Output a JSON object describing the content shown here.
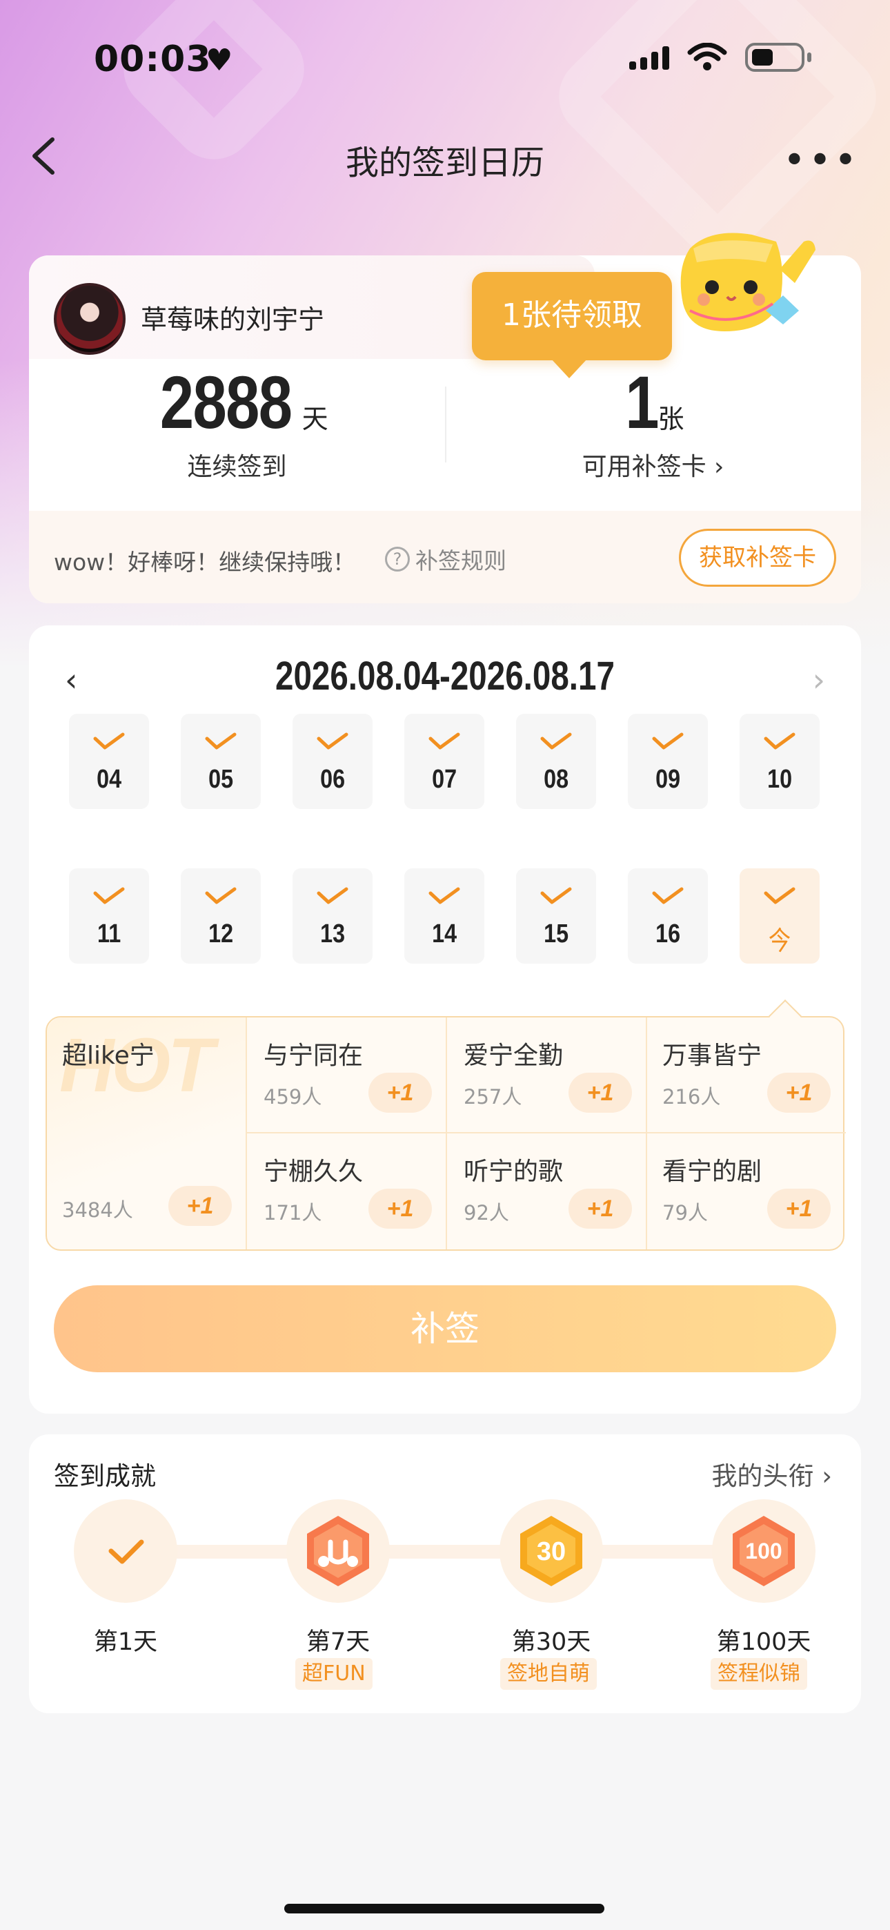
{
  "status_bar": {
    "time": "00:03",
    "heart": "♥"
  },
  "nav": {
    "title": "我的签到日历",
    "back_icon": "chevron-left-icon",
    "more_label": "•••"
  },
  "user": {
    "name": "草莓味的刘宇宁"
  },
  "stats": {
    "streak_value": "2888",
    "streak_unit": "天",
    "streak_label": "连续签到",
    "cards_value": "1",
    "cards_unit": "张",
    "cards_label": "可用补签卡 ›"
  },
  "pending_tip": "1张待领取",
  "encouragement": "wow！好棒呀！继续保持哦！",
  "rules_label": "补签规则",
  "get_card_button": "获取补签卡",
  "calendar": {
    "range": "2026.08.04-2026.08.17",
    "prev": "‹",
    "next": "›",
    "days": [
      "04",
      "05",
      "06",
      "07",
      "08",
      "09",
      "10",
      "11",
      "12",
      "13",
      "14",
      "15",
      "16",
      "今"
    ]
  },
  "topics": {
    "hot_watermark": "HOT",
    "hot": {
      "name": "超like宁",
      "count": "3484人",
      "plus": "+1"
    },
    "items": [
      {
        "name": "与宁同在",
        "count": "459人",
        "plus": "+1"
      },
      {
        "name": "爱宁全勤",
        "count": "257人",
        "plus": "+1"
      },
      {
        "name": "万事皆宁",
        "count": "216人",
        "plus": "+1"
      },
      {
        "name": "宁棚久久",
        "count": "171人",
        "plus": "+1"
      },
      {
        "name": "听宁的歌",
        "count": "92人",
        "plus": "+1"
      },
      {
        "name": "看宁的剧",
        "count": "79人",
        "plus": "+1"
      }
    ]
  },
  "resign_button": "补签",
  "achievements": {
    "title": "签到成就",
    "my_titles": "我的头衔 ›",
    "milestones": [
      {
        "day": "第1天",
        "tag": ""
      },
      {
        "day": "第7天",
        "tag": "超FUN"
      },
      {
        "day": "第30天",
        "tag": "签地自萌"
      },
      {
        "day": "第100天",
        "tag": "签程似锦"
      }
    ]
  },
  "colors": {
    "accent": "#f29020",
    "pending": "#f5b13b",
    "button_start": "#ffc48b",
    "button_end": "#ffdb91"
  }
}
